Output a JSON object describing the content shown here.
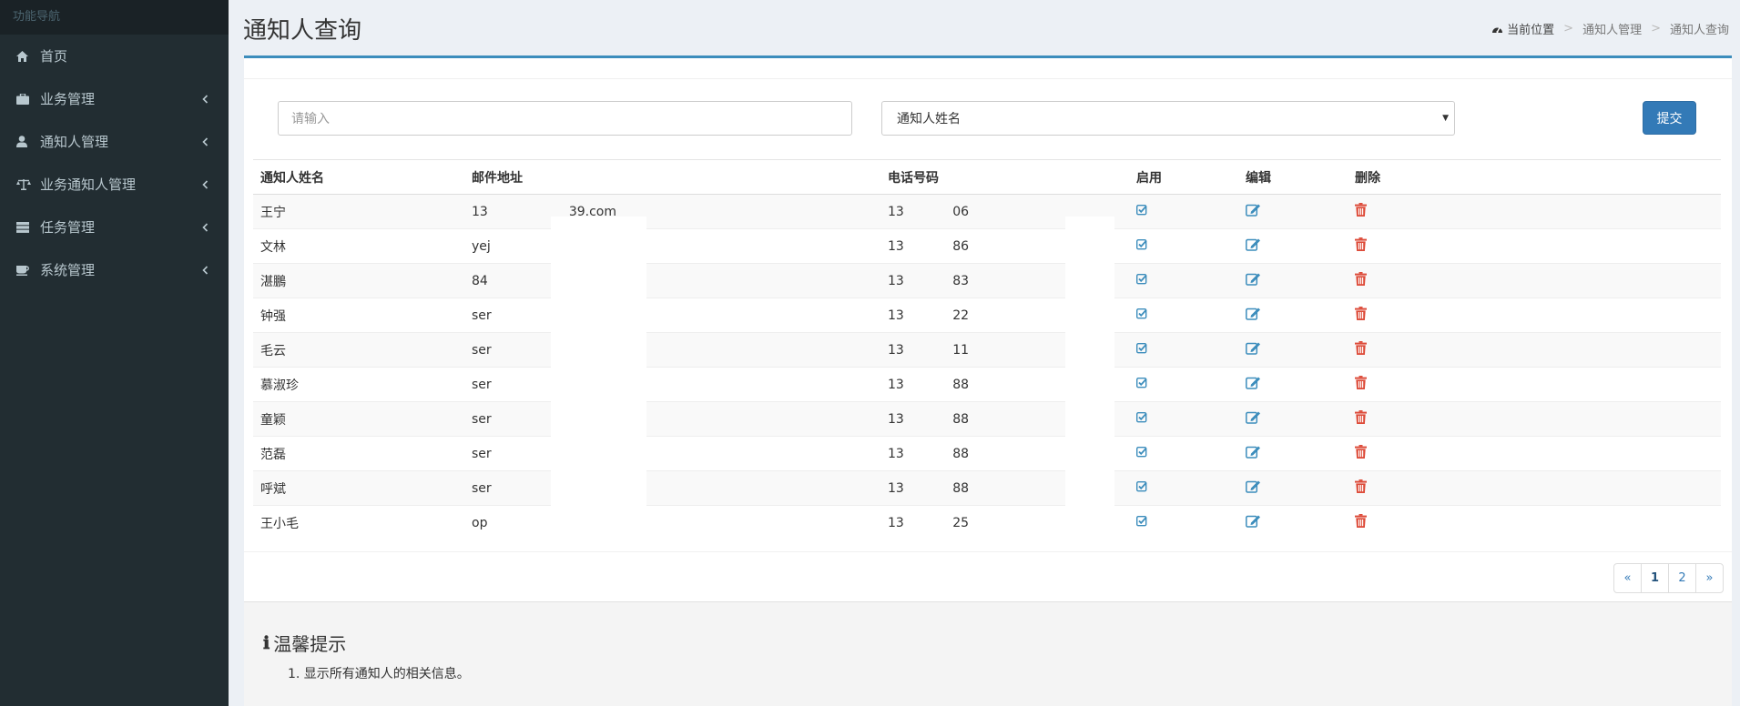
{
  "sidebar": {
    "header": "功能导航",
    "items": [
      {
        "label": "首页",
        "icon": "home-icon",
        "has_chevron": false
      },
      {
        "label": "业务管理",
        "icon": "briefcase-icon",
        "has_chevron": true
      },
      {
        "label": "通知人管理",
        "icon": "user-icon",
        "has_chevron": true
      },
      {
        "label": "业务通知人管理",
        "icon": "balance-scale-icon",
        "has_chevron": true
      },
      {
        "label": "任务管理",
        "icon": "server-icon",
        "has_chevron": true
      },
      {
        "label": "系统管理",
        "icon": "coffee-icon",
        "has_chevron": true
      }
    ]
  },
  "header": {
    "title": "通知人查询",
    "breadcrumb": {
      "home": "当前位置",
      "level1": "通知人管理",
      "level2": "通知人查询"
    }
  },
  "search": {
    "placeholder": "请输入",
    "select_value": "通知人姓名",
    "submit_label": "提交"
  },
  "table": {
    "headers": [
      "通知人姓名",
      "邮件地址",
      "电话号码",
      "启用",
      "编辑",
      "删除"
    ],
    "rows": [
      {
        "name": "王宁",
        "email": "13                    39.com",
        "phone": "13            06"
      },
      {
        "name": "文林",
        "email": "yej                   m",
        "phone": "13            86"
      },
      {
        "name": "湛鵬",
        "email": "84                    om",
        "phone": "13            83"
      },
      {
        "name": "钟强",
        "email": "ser                   o.com",
        "phone": "13            22"
      },
      {
        "name": "毛云",
        "email": "ser                   vo.com",
        "phone": "13            11"
      },
      {
        "name": "慕淑珍",
        "email": "ser                   vo.com",
        "phone": "13            88"
      },
      {
        "name": "童颖",
        "email": "ser                   vo.com",
        "phone": "13            88"
      },
      {
        "name": "范磊",
        "email": "ser                   vo.com",
        "phone": "13            88"
      },
      {
        "name": "呼斌",
        "email": "ser                   vo.com",
        "phone": "13            88"
      },
      {
        "name": "王小毛",
        "email": "op",
        "phone": "13            25"
      }
    ]
  },
  "pagination": {
    "prev": "«",
    "pages": [
      "1",
      "2"
    ],
    "next": "»",
    "current": "1"
  },
  "tip": {
    "title": "温馨提示",
    "text": "1. 显示所有通知人的相关信息。"
  },
  "colors": {
    "sidebar_bg": "#222d32",
    "accent": "#3c8dbc",
    "button": "#337ab7",
    "delete": "#dd4b39"
  }
}
